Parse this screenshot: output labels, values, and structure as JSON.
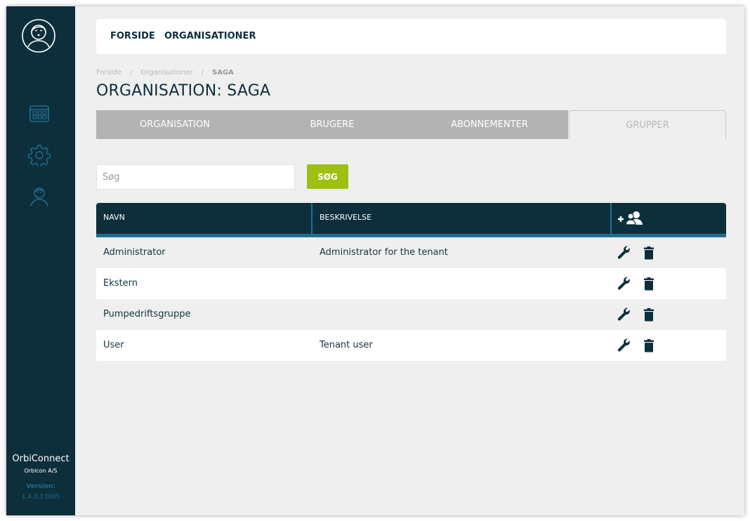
{
  "sidebar": {
    "brand_title": "OrbiConnect",
    "brand_company": "Orbicon A/S",
    "version_label": "Version:",
    "version": "1.4.0.13085"
  },
  "topnav": {
    "home": "FORSIDE",
    "organisations": "ORGANISATIONER"
  },
  "breadcrumb": {
    "home": "Forside",
    "sep1": "/",
    "organisations": "Organisationer",
    "sep2": "/",
    "current": "SAGA"
  },
  "page_title": "ORGANISATION: SAGA",
  "tabs": [
    {
      "label": "ORGANISATION"
    },
    {
      "label": "BRUGERE"
    },
    {
      "label": "ABONNEMENTER"
    },
    {
      "label": "GRUPPER",
      "active": true
    }
  ],
  "search": {
    "placeholder": "Søg",
    "value": "",
    "button_label": "SØG"
  },
  "table": {
    "columns": [
      "NAVN",
      "BESKRIVELSE"
    ],
    "rows": [
      {
        "name": "Administrator",
        "description": "Administrator for the tenant"
      },
      {
        "name": "Ekstern",
        "description": ""
      },
      {
        "name": "Pumpedriftsgruppe",
        "description": ""
      },
      {
        "name": "User",
        "description": "Tenant user"
      }
    ]
  },
  "colors": {
    "sidebar": "#0d2f3b",
    "accent": "#9ec011",
    "header_accent": "#1f6e8e",
    "tab_inactive": "#b3b3b3"
  },
  "icons": {
    "avatar": "user-avatar-icon",
    "nav_dashboard": "dashboard-grid-icon",
    "nav_settings": "gear-icon",
    "nav_users": "user-icon",
    "add_group": "add-group-icon",
    "edit": "wrench-icon",
    "delete": "trash-icon"
  }
}
